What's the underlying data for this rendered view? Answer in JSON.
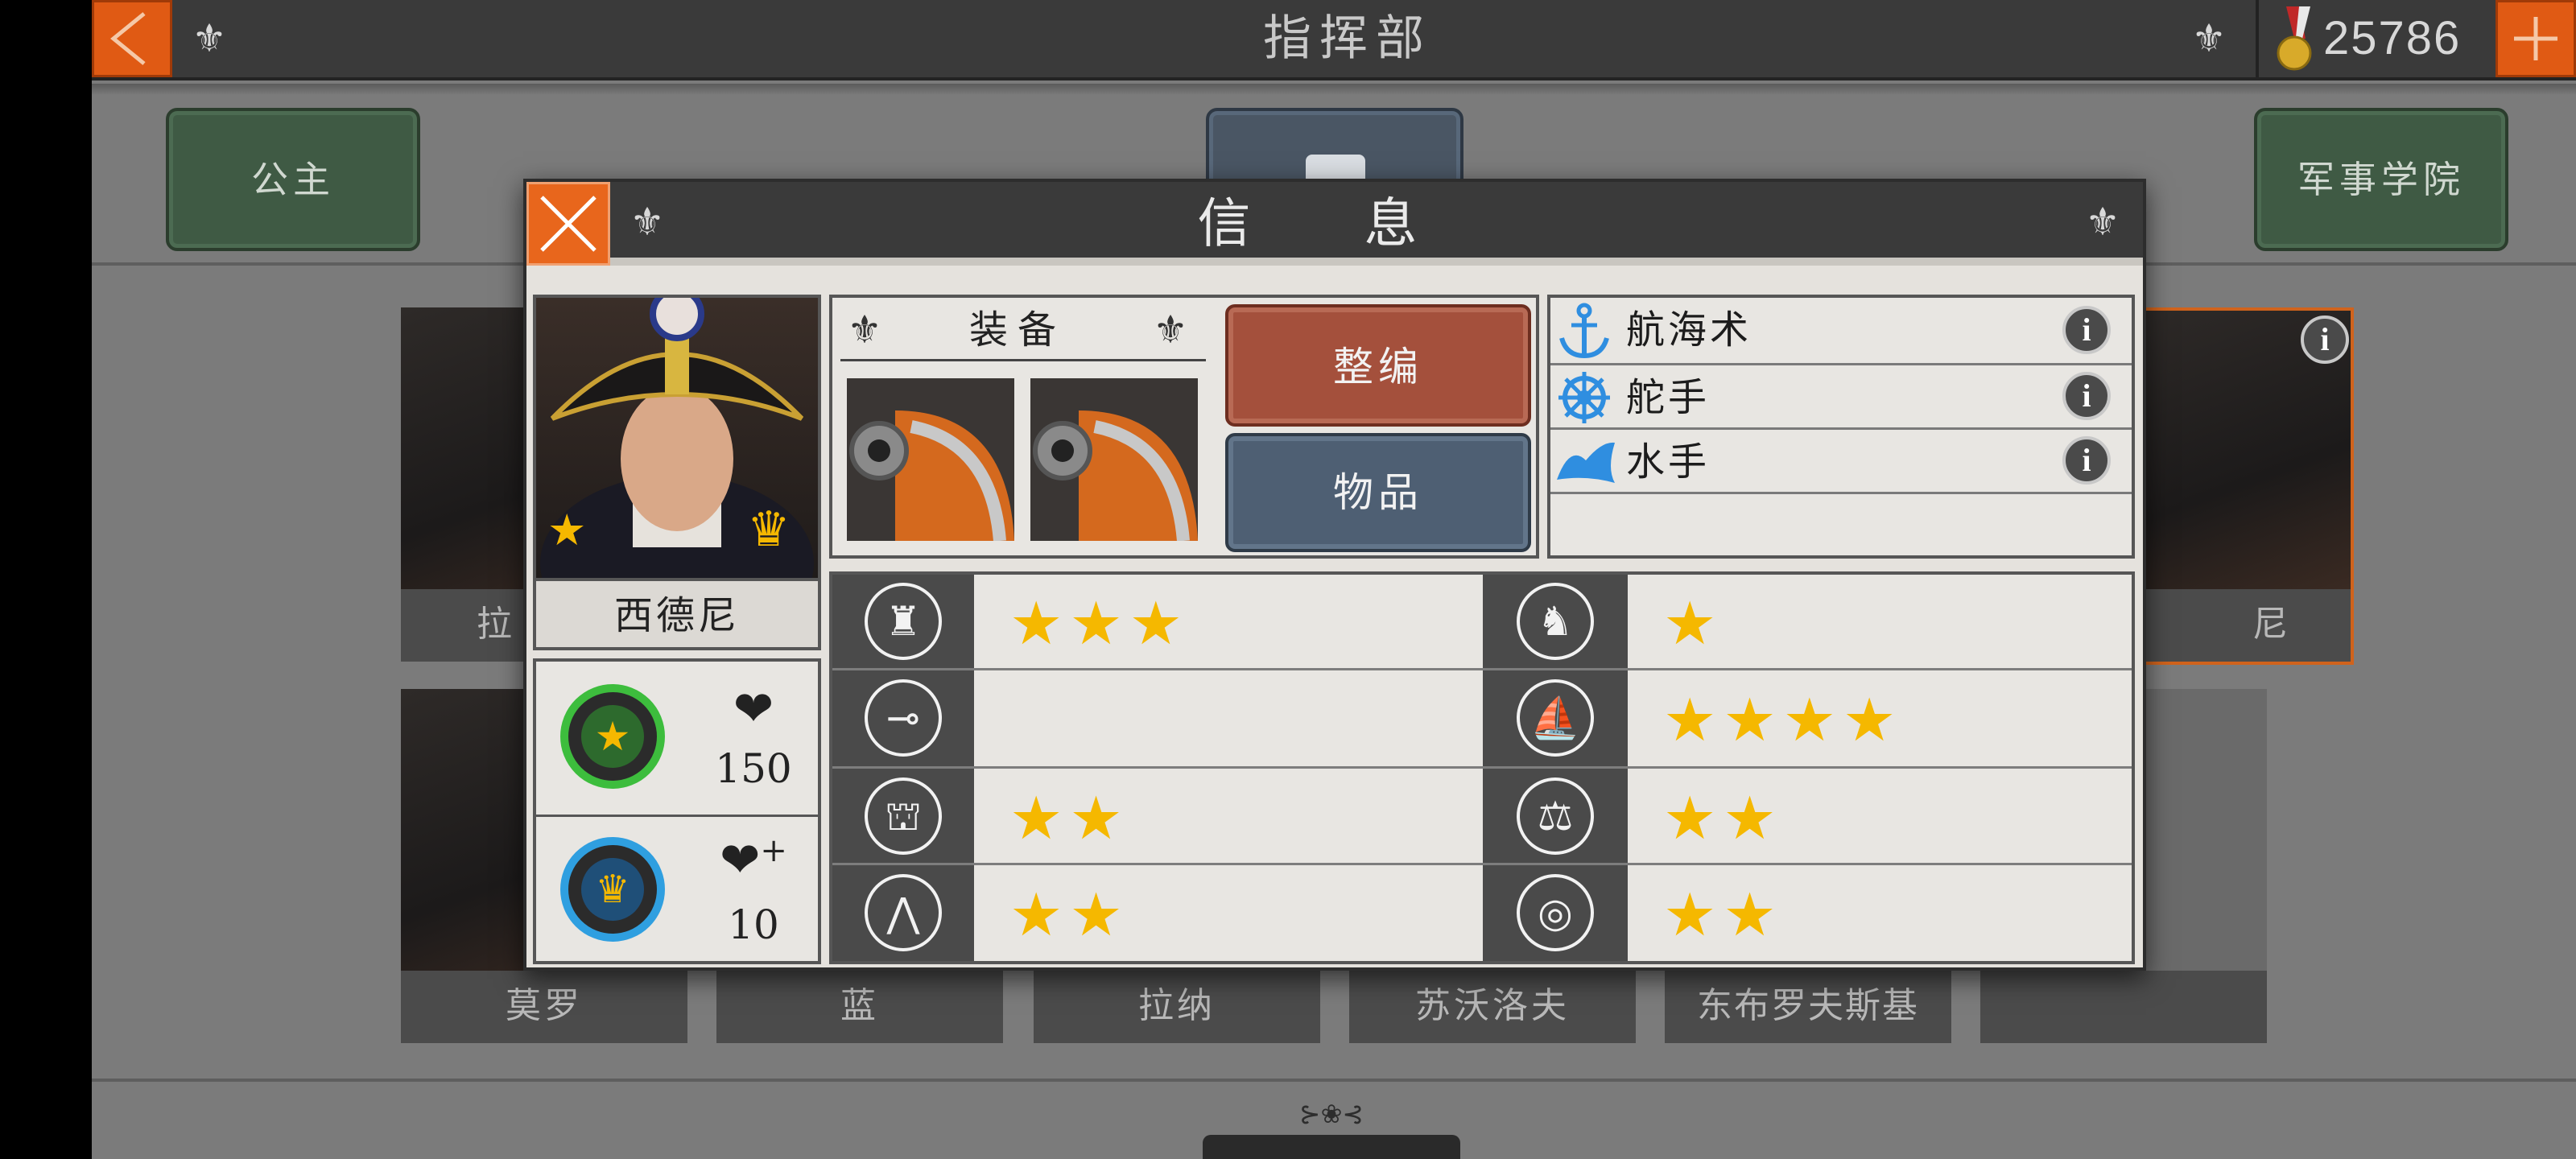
{
  "header": {
    "title": "指挥部",
    "gold_amount": "25786"
  },
  "tabs": {
    "left_label": "公主",
    "right_label": "军事学院"
  },
  "background_cards": {
    "top_row": [
      "拉",
      "尼"
    ],
    "bottom_row": [
      "莫罗",
      "蓝",
      "拉纳",
      "苏沃洛夫",
      "东布罗夫斯基",
      ""
    ]
  },
  "dialog": {
    "title": "信 息",
    "officer": {
      "name": "西德尼",
      "health": "150",
      "heal": "10"
    },
    "equipment": {
      "label": "装备",
      "items": [
        "cannon",
        "cannon"
      ]
    },
    "buttons": {
      "reorganize": "整编",
      "items": "物品"
    },
    "skills": [
      {
        "name": "航海术",
        "icon": "anchor-icon"
      },
      {
        "name": "舵手",
        "icon": "ship-wheel-icon"
      },
      {
        "name": "水手",
        "icon": "sailor-hat-icon"
      }
    ],
    "stats_left": [
      {
        "icon": "infantry-icon",
        "stars": 3
      },
      {
        "icon": "artillery-icon",
        "stars": 0
      },
      {
        "icon": "fortification-icon",
        "stars": 2
      },
      {
        "icon": "march-icon",
        "stars": 2
      }
    ],
    "stats_right": [
      {
        "icon": "cavalry-icon",
        "stars": 1
      },
      {
        "icon": "navy-icon",
        "stars": 4
      },
      {
        "icon": "balance-icon",
        "stars": 2
      },
      {
        "icon": "target-icon",
        "stars": 2
      }
    ]
  },
  "colors": {
    "accent_orange": "#e05a14",
    "star_gold": "#f5b800",
    "button_brown": "#a4503c",
    "button_slate": "#4e5f73"
  }
}
